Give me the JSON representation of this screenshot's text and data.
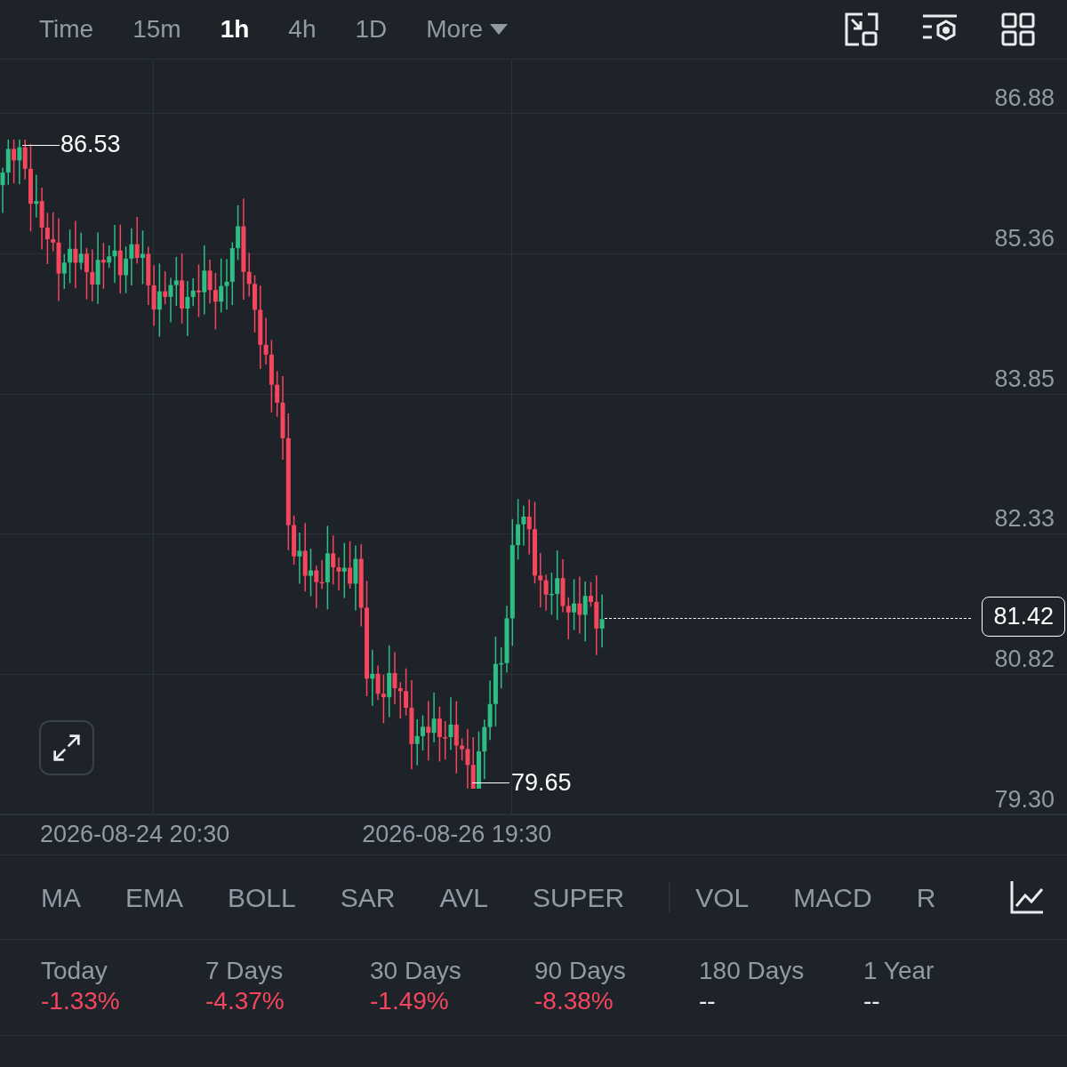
{
  "toolbar": {
    "intervals": [
      {
        "label": "Time",
        "selected": false
      },
      {
        "label": "15m",
        "selected": false
      },
      {
        "label": "1h",
        "selected": true
      },
      {
        "label": "4h",
        "selected": false
      },
      {
        "label": "1D",
        "selected": false
      }
    ],
    "more": "More"
  },
  "chart": {
    "price_ticks": [
      "86.88",
      "85.36",
      "83.85",
      "82.33",
      "80.82",
      "79.30"
    ],
    "high_label": "86.53",
    "low_label": "79.65",
    "last_price": "81.42",
    "date_labels": [
      "2026-08-24 20:30",
      "2026-08-26 19:30"
    ]
  },
  "indicators": [
    {
      "label": "MA",
      "kind": "main"
    },
    {
      "label": "EMA",
      "kind": "main"
    },
    {
      "label": "BOLL",
      "kind": "main"
    },
    {
      "label": "SAR",
      "kind": "main"
    },
    {
      "label": "AVL",
      "kind": "main"
    },
    {
      "label": "SUPER",
      "kind": "main"
    },
    {
      "label": "VOL",
      "kind": "sub"
    },
    {
      "label": "MACD",
      "kind": "sub"
    },
    {
      "label": "R",
      "kind": "sub"
    }
  ],
  "stats": [
    {
      "label": "Today",
      "value": "-1.33%",
      "color": "#f6465d"
    },
    {
      "label": "7 Days",
      "value": "-4.37%",
      "color": "#f6465d"
    },
    {
      "label": "30 Days",
      "value": "-1.49%",
      "color": "#f6465d"
    },
    {
      "label": "90 Days",
      "value": "-8.38%",
      "color": "#f6465d"
    },
    {
      "label": "180 Days",
      "value": "--",
      "color": "#eaecef"
    },
    {
      "label": "1 Year",
      "value": "--",
      "color": "#eaecef"
    }
  ]
}
